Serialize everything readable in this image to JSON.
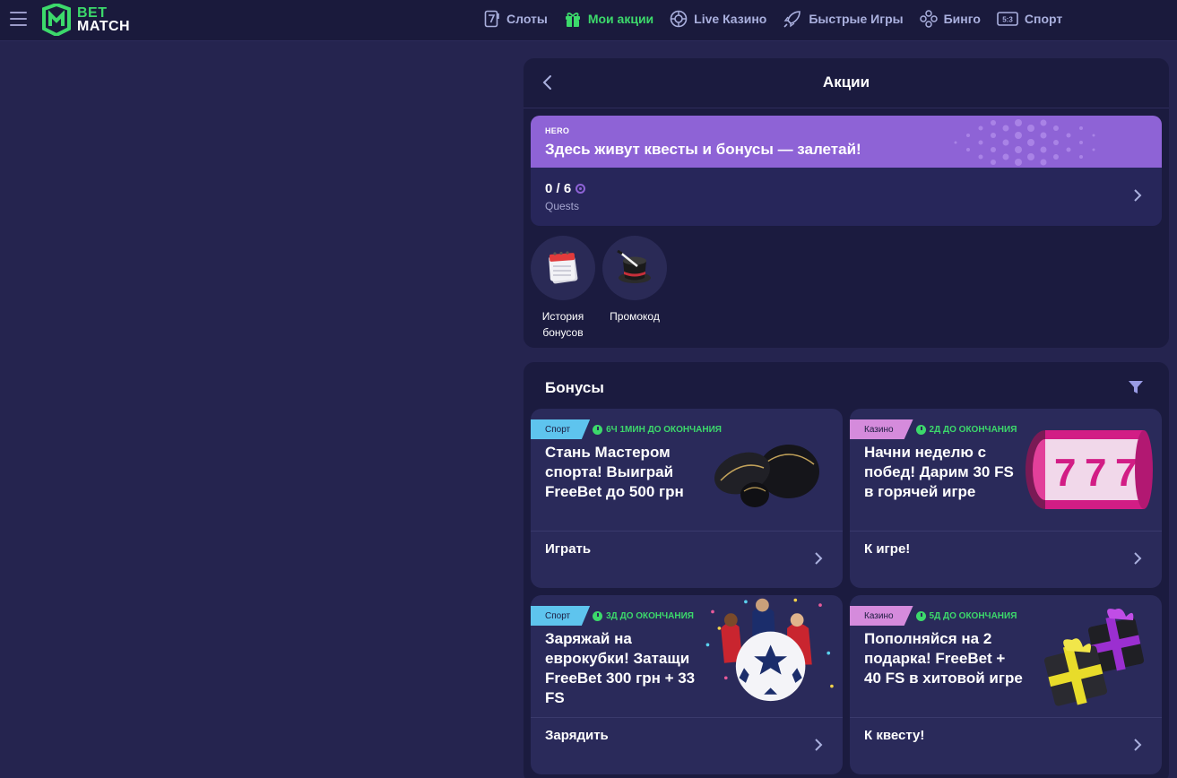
{
  "header": {
    "logo": {
      "line1": "BET",
      "line2": "MATCH"
    },
    "nav": [
      {
        "label": "Слоты",
        "icon": "slot-seven-icon",
        "active": false
      },
      {
        "label": "Мои акции",
        "icon": "gift-icon",
        "active": true
      },
      {
        "label": "Live Казино",
        "icon": "roulette-icon",
        "active": false
      },
      {
        "label": "Быстрые Игры",
        "icon": "rocket-icon",
        "active": false
      },
      {
        "label": "Бинго",
        "icon": "bingo-icon",
        "active": false
      },
      {
        "label": "Спорт",
        "icon": "scoreboard-icon",
        "active": false
      }
    ],
    "scoreboard_icon_text": "5:3"
  },
  "promotions": {
    "title": "Акции",
    "hero": {
      "tag": "HERO",
      "text": "Здесь живут квесты и бонусы — залетай!",
      "quest_count": "0 / 6",
      "quest_label": "Quests"
    },
    "shortcuts": [
      {
        "label": "История бонусов",
        "icon": "calendar-icon"
      },
      {
        "label": "Промокод",
        "icon": "magic-hat-icon"
      }
    ]
  },
  "bonuses": {
    "title": "Бонусы",
    "cards": [
      {
        "category": "Спорт",
        "timer": "6Ч 1МИН ДО ОКОНЧАНИЯ",
        "title": "Стань Мастером спорта! Выиграй FreeBet до 500 грн",
        "action": "Играть",
        "art": "footballs-image"
      },
      {
        "category": "Казино",
        "timer": "2Д ДО ОКОНЧАНИЯ",
        "title": "Начни неделю с побед! Дарим 30 FS в горячей игре",
        "action": "К игре!",
        "art": "slot-reels-image"
      },
      {
        "category": "Спорт",
        "timer": "3Д ДО ОКОНЧАНИЯ",
        "title": "Заряжай на еврокубки! Затащи FreeBet 300 грн + 33 FS",
        "action": "Зарядить",
        "art": "champions-ball-image"
      },
      {
        "category": "Казино",
        "timer": "5Д ДО ОКОНЧАНИЯ",
        "title": "Пополняйся на 2 подарка! FreeBet + 40 FS в хитовой игре",
        "action": "К квесту!",
        "art": "gift-boxes-image"
      }
    ]
  },
  "colors": {
    "background": "#25244f",
    "topbar": "#1a1a3c",
    "panel": "#1b1b3f",
    "card": "#2a2a5a",
    "accent_green": "#3cd96b",
    "hero_purple": "#8e63d6",
    "sport_badge": "#5ec4ee",
    "casino_badge": "#d58bdc"
  }
}
